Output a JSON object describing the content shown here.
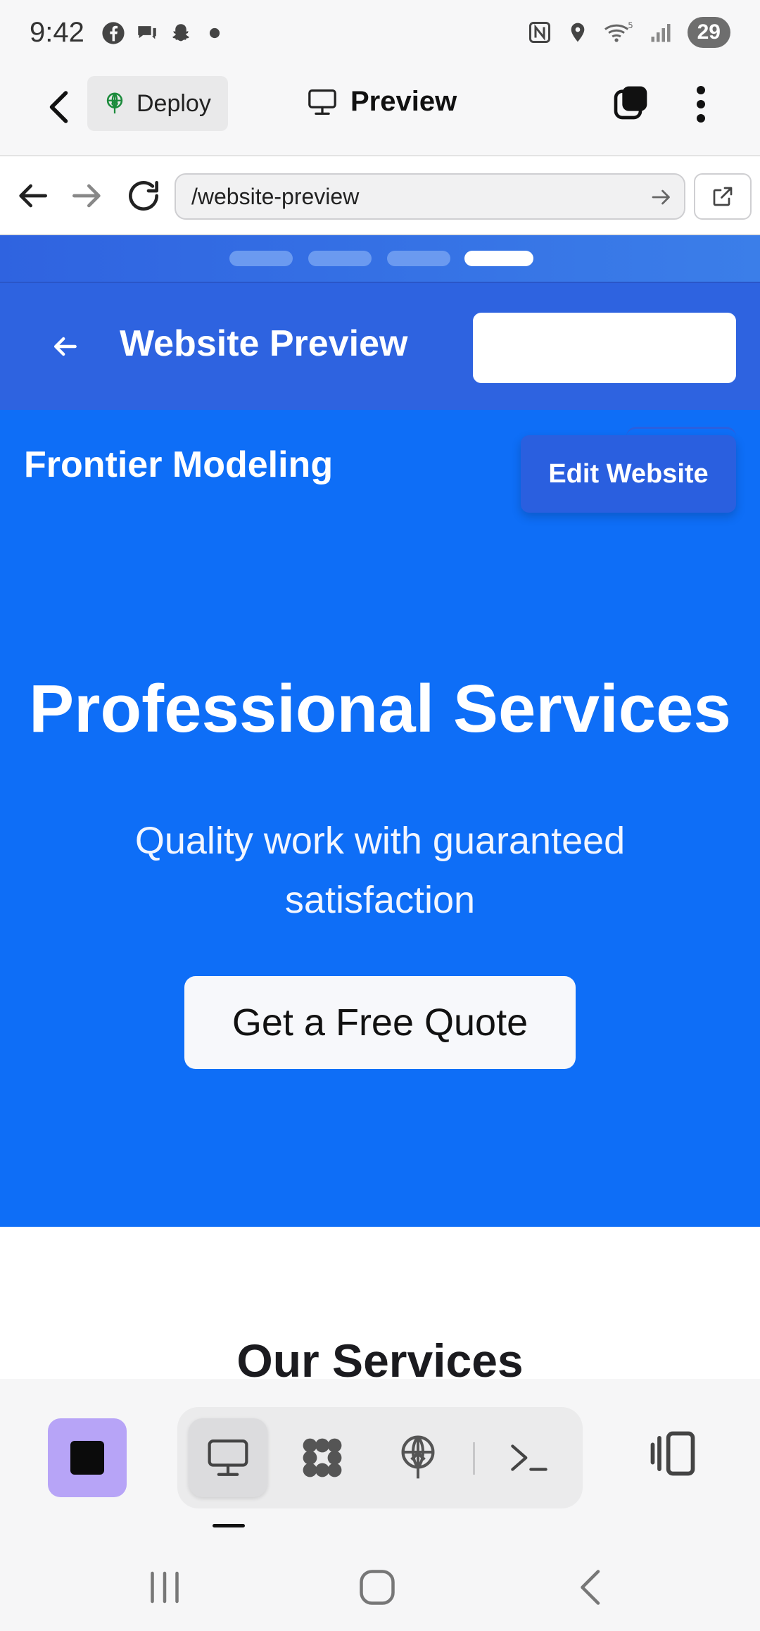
{
  "status_bar": {
    "time": "9:42",
    "battery": "29",
    "wifi_label": "5"
  },
  "app_bar": {
    "deploy_label": "Deploy",
    "title": "Preview"
  },
  "browser": {
    "url": "/website-preview"
  },
  "preview_header": {
    "title": "Website Preview",
    "steps_total": 4,
    "active_step": 4
  },
  "site": {
    "brand": "Frontier Modeling",
    "edit_button": "Edit Website",
    "hero_title": "Professional Services",
    "hero_subtitle": "Quality work with guaranteed satisfaction",
    "cta": "Get a Free Quote",
    "section_title": "Our Services"
  },
  "colors": {
    "hero_bg": "#0e6ef7",
    "header_bg": "#2e63e0",
    "stop_btn": "#b7a4f7"
  },
  "toolbar": {
    "items": [
      "monitor-icon",
      "grid-icon",
      "deploy-icon",
      "terminal-icon"
    ],
    "active": "monitor-icon"
  }
}
